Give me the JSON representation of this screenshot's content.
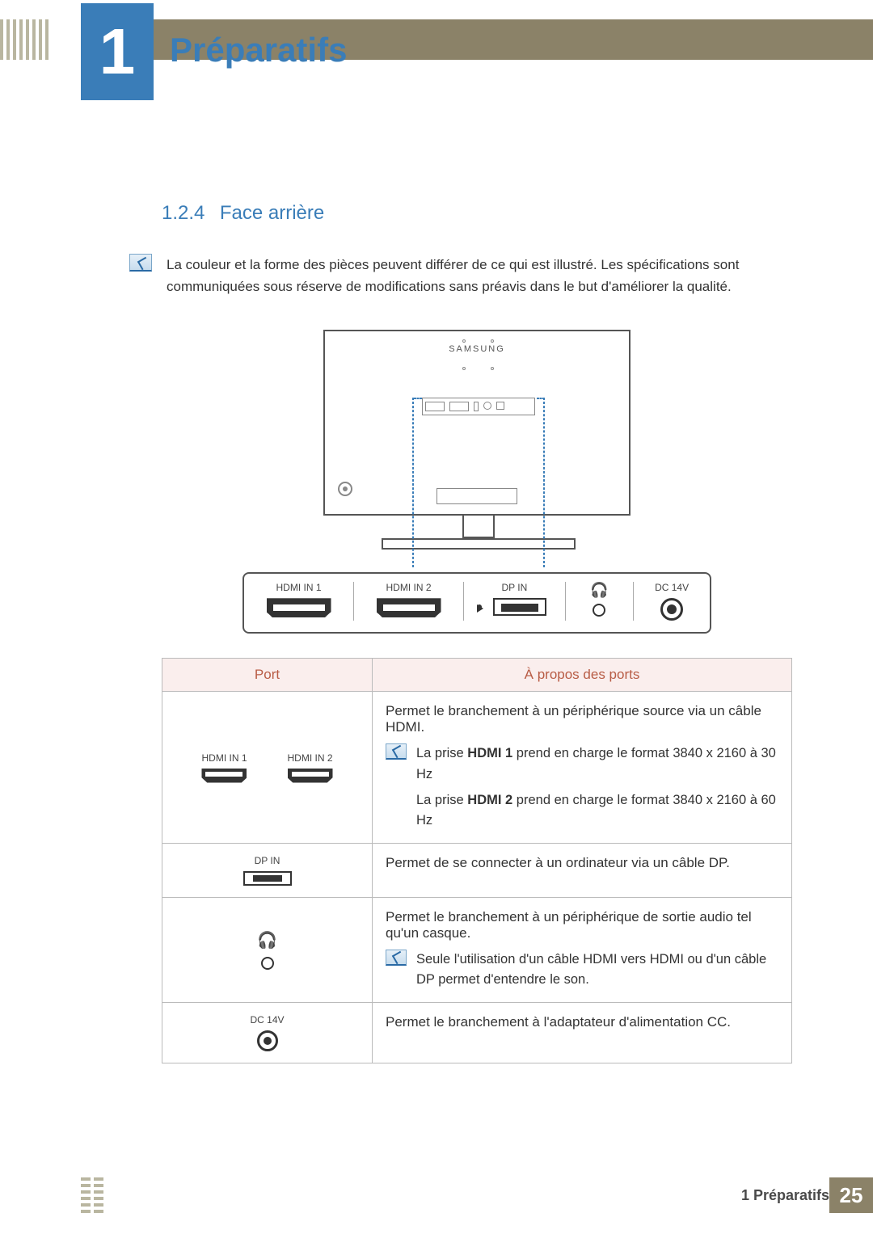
{
  "chapter": {
    "number": "1",
    "title": "Préparatifs"
  },
  "section": {
    "number": "1.2.4",
    "title": "Face arrière"
  },
  "intro_note": "La couleur et la forme des pièces peuvent différer de ce qui est illustré. Les spécifications sont communiquées sous réserve de modifications sans préavis dans le but d'améliorer la qualité.",
  "figure": {
    "brand": "SAMSUNG",
    "port_labels": {
      "hdmi1": "HDMI IN 1",
      "hdmi2": "HDMI IN 2",
      "dp": "DP IN",
      "dc": "DC 14V"
    }
  },
  "table": {
    "headers": {
      "port": "Port",
      "about": "À propos des ports"
    },
    "rows": [
      {
        "port_labels": {
          "hdmi1": "HDMI IN 1",
          "hdmi2": "HDMI IN 2"
        },
        "desc_main": "Permet le branchement à un périphérique source via un câble HDMI.",
        "note_lines": [
          {
            "prefix": "La prise ",
            "bold": "HDMI 1",
            "suffix": " prend en charge le format 3840 x 2160 à 30 Hz"
          },
          {
            "prefix": "La prise ",
            "bold": "HDMI 2",
            "suffix": " prend en charge le format 3840 x 2160 à 60 Hz"
          }
        ]
      },
      {
        "port_labels": {
          "dp": "DP IN"
        },
        "desc_main": "Permet de se connecter à un ordinateur via un câble DP."
      },
      {
        "desc_main": "Permet le branchement à un périphérique de sortie audio tel qu'un casque.",
        "note_text": "Seule l'utilisation d'un câble HDMI vers HDMI ou d'un câble DP permet d'entendre le son."
      },
      {
        "port_labels": {
          "dc": "DC 14V"
        },
        "desc_main": "Permet le branchement à l'adaptateur d'alimentation CC."
      }
    ]
  },
  "footer": {
    "crumb": "1 Préparatifs",
    "page": "25"
  }
}
